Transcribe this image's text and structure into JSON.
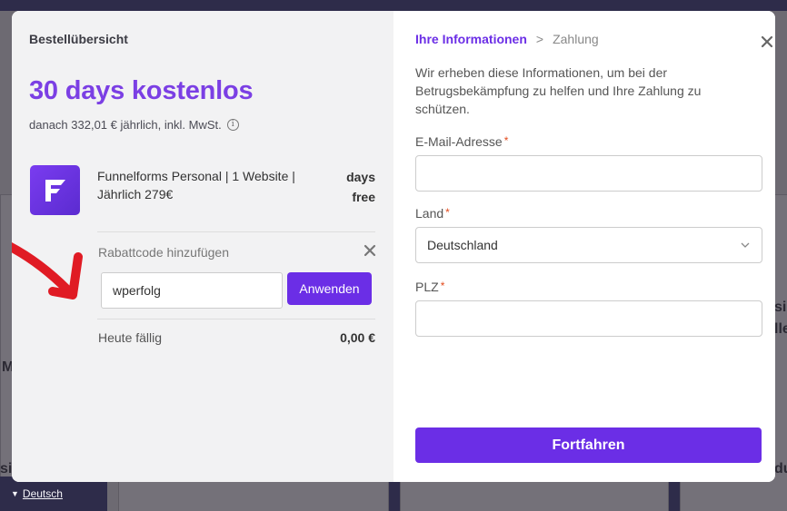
{
  "order_summary": {
    "title": "Bestellübersicht",
    "trial_headline": "30 days kostenlos",
    "price_line": "danach 332,01 € jährlich, inkl. MwSt.",
    "info_icon": "info-icon",
    "product": {
      "name": "Funnelforms Personal | 1 Website | Jährlich 279€",
      "price_line1": "days",
      "price_line2": "free",
      "logo_icon": "funnelforms-logo"
    },
    "coupon": {
      "label": "Rabattcode hinzufügen",
      "value": "wperfolg",
      "apply_label": "Anwenden"
    },
    "due_today": {
      "label": "Heute fällig",
      "value": "0,00 €"
    }
  },
  "checkout": {
    "breadcrumb": {
      "active": "Ihre Informationen",
      "separator": ">",
      "next": "Zahlung"
    },
    "intro": "Wir erheben diese Informationen, um bei der Betrugsbekämpfung zu helfen und Ihre Zahlung zu schützen.",
    "fields": {
      "email_label": "E-Mail-Adresse",
      "country_label": "Land",
      "country_value": "Deutschland",
      "zip_label": "PLZ",
      "required_mark": "*"
    },
    "continue_label": "Fortfahren"
  },
  "background": {
    "language": "Deutsch",
    "fragments": [
      "M",
      "si",
      "si",
      "lle",
      "du"
    ]
  },
  "colors": {
    "accent": "#6b2ee6",
    "headline": "#7b3fe4",
    "required": "#e24a1c",
    "annotation_arrow": "#e01b24"
  }
}
